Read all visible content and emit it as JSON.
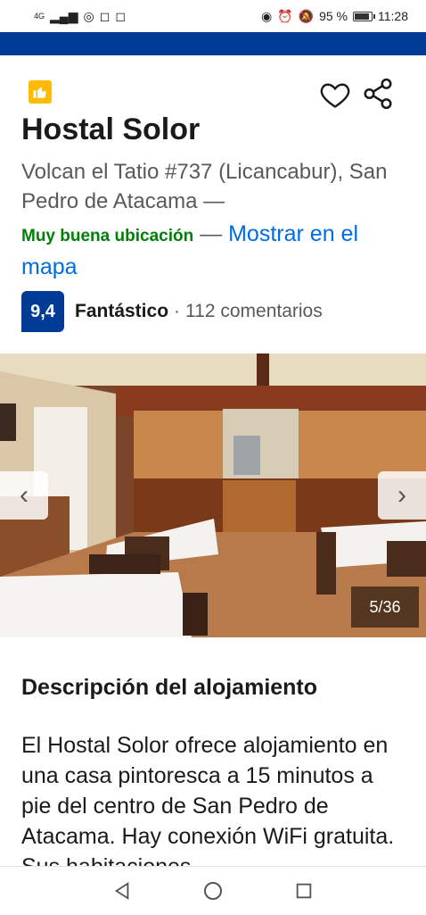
{
  "status_bar": {
    "network": "4G",
    "battery_percent": "95 %",
    "time": "11:28"
  },
  "property": {
    "name": "Hostal Solor",
    "address": "Volcan el Tatio #737 (Licancabur), San Pedro de Atacama —",
    "location_rating": "Muy buena ubicación",
    "location_sep": " — ",
    "map_link": "Mostrar en el mapa",
    "score": "9,4",
    "score_label": "Fantástico",
    "score_separator": "·",
    "reviews": "112 comentarios"
  },
  "gallery": {
    "counter": "5/36",
    "prev_icon": "chevron-left-icon",
    "next_icon": "chevron-right-icon"
  },
  "description": {
    "heading": "Descripción del alojamiento",
    "body": "El Hostal Solor ofrece alojamiento en una casa pintoresca a 15 minutos a pie del centro de San Pedro de Atacama. Hay conexión WiFi gratuita. Sus habitaciones"
  },
  "colors": {
    "brand_blue": "#003b95",
    "link_blue": "#006ce4",
    "good_green": "#008009",
    "badge_yellow": "#febb02"
  }
}
